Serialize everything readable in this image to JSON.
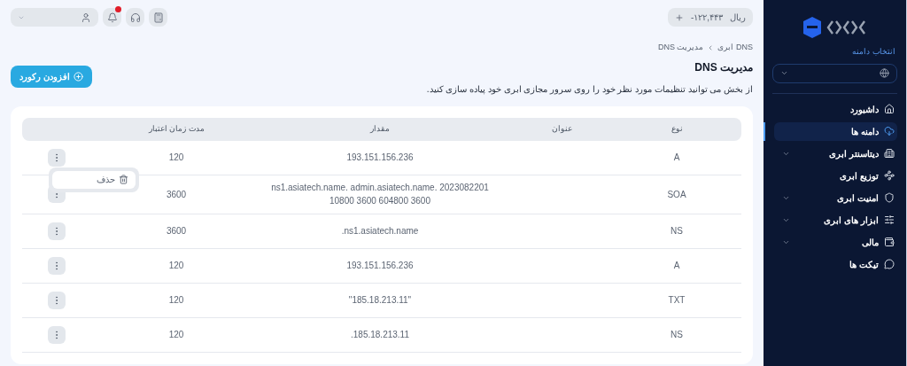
{
  "topbar": {
    "balance": "-۱۲۲,۴۴۳",
    "currency": "ریال",
    "notifications_unread": true
  },
  "breadcrumb": [
    "DNS ابری",
    "مدیریت DNS"
  ],
  "page": {
    "title": "مدیریت DNS",
    "description": "از بخش می توانید تنظیمات مورد نظر خود را روی سرور مجازی ابری خود پیاده سازی کنید.",
    "add_button": "افزودن رکورد"
  },
  "table": {
    "columns": [
      "نوع",
      "عنوان",
      "مقدار",
      "مدت زمان اعتبار"
    ],
    "rows": [
      {
        "type": "A",
        "value": "193.151.156.236",
        "ttl": "120",
        "menu_open": true
      },
      {
        "type": "SOA",
        "value": "ns1.asiatech.name. admin.asiatech.name. 2023082201 10800 3600 604800 3600",
        "ttl": "3600",
        "menu_open": false
      },
      {
        "type": "NS",
        "value": "ns1.asiatech.name.",
        "ttl": "3600",
        "menu_open": false
      },
      {
        "type": "A",
        "value": "193.151.156.236",
        "ttl": "120",
        "menu_open": false
      },
      {
        "type": "TXT",
        "value": "\"185.18.213.11\"",
        "ttl": "120",
        "menu_open": false
      },
      {
        "type": "NS",
        "value": "185.18.213.11.",
        "ttl": "120",
        "menu_open": false
      }
    ],
    "row_menu": [
      {
        "label": "حذف",
        "kind": "delete"
      }
    ]
  },
  "sidebar": {
    "domain_label": "انتخاب دامنه",
    "items": [
      {
        "label": "داشبورد",
        "expandable": false,
        "selected": false
      },
      {
        "label": "دامنه ها",
        "expandable": false,
        "selected": true
      },
      {
        "label": "دیتاسنتر ابری",
        "expandable": true,
        "selected": false
      },
      {
        "label": "توزیع ابری",
        "expandable": false,
        "selected": false
      },
      {
        "label": "امنیت ابری",
        "expandable": true,
        "selected": false
      },
      {
        "label": "ابزار های ابری",
        "expandable": true,
        "selected": false
      },
      {
        "label": "مالی",
        "expandable": true,
        "selected": false
      },
      {
        "label": "تیکت ها",
        "expandable": false,
        "selected": false
      }
    ]
  }
}
